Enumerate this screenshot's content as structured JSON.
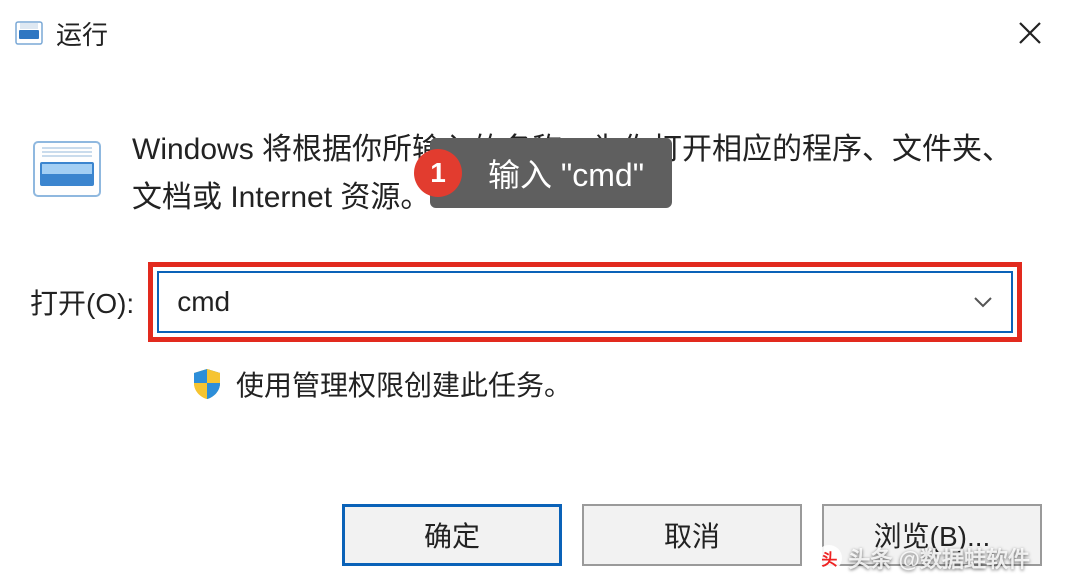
{
  "title": "运行",
  "description": "Windows 将根据你所输入的名称，为你打开相应的程序、文件夹、文档或 Internet 资源。",
  "callout": {
    "number": "1",
    "text": "输入 \"cmd\""
  },
  "open": {
    "label": "打开(O):",
    "value": "cmd"
  },
  "admin_note": "使用管理权限创建此任务。",
  "buttons": {
    "ok": "确定",
    "cancel": "取消",
    "browse": "浏览(B)..."
  },
  "watermark": "头条 @数据蛙软件"
}
